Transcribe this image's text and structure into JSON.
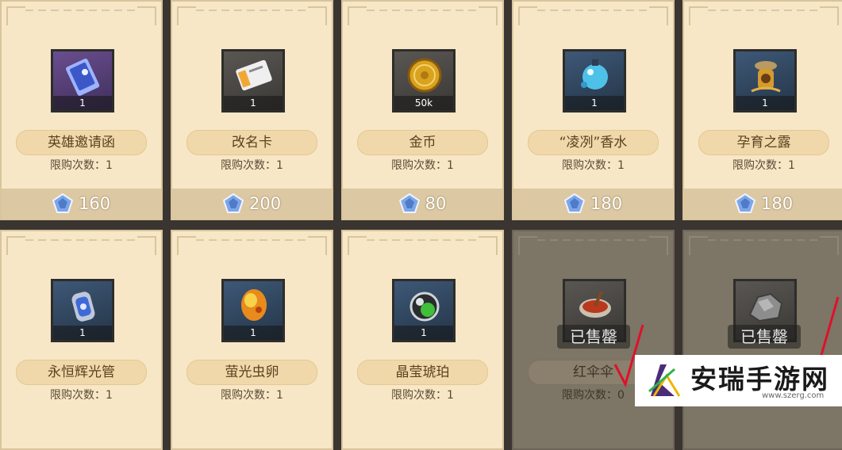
{
  "items": [
    {
      "name": "英雄邀请函",
      "limit": "限购次数：1",
      "qty": "1",
      "price": "160",
      "sold": false,
      "icon": "hero-invitation-icon"
    },
    {
      "name": "改名卡",
      "limit": "限购次数：1",
      "qty": "1",
      "price": "200",
      "sold": false,
      "icon": "rename-card-icon"
    },
    {
      "name": "金币",
      "limit": "限购次数：1",
      "qty": "50k",
      "price": "80",
      "sold": false,
      "icon": "gold-coin-icon"
    },
    {
      "name": "“凌冽”香水",
      "limit": "限购次数：1",
      "qty": "1",
      "price": "180",
      "sold": false,
      "icon": "perfume-icon"
    },
    {
      "name": "孕育之露",
      "limit": "限购次数：1",
      "qty": "1",
      "price": "180",
      "sold": false,
      "icon": "dew-icon"
    },
    {
      "name": "永恒辉光管",
      "limit": "限购次数：1",
      "qty": "1",
      "price": "",
      "sold": false,
      "icon": "glow-tube-icon"
    },
    {
      "name": "萤光虫卵",
      "limit": "限购次数：1",
      "qty": "1",
      "price": "",
      "sold": false,
      "icon": "firefly-egg-icon"
    },
    {
      "name": "晶莹琥珀",
      "limit": "限购次数：1",
      "qty": "1",
      "price": "",
      "sold": false,
      "icon": "amber-icon"
    },
    {
      "name": "红伞伞",
      "limit": "限购次数：0",
      "qty": "",
      "price": "",
      "sold": true,
      "sold_label": "已售罄",
      "icon": "red-soup-icon"
    },
    {
      "name": "",
      "limit": "",
      "qty": "",
      "price": "",
      "sold": true,
      "sold_label": "已售罄",
      "icon": "ore-icon"
    }
  ],
  "watermark": {
    "title": "安瑞手游网",
    "url": "www.szerg.com"
  },
  "colors": {
    "card": "#f7e7c6",
    "sold_card": "#7d7565",
    "price_bar": "#dcc8a2",
    "scribble": "#e0102a"
  }
}
